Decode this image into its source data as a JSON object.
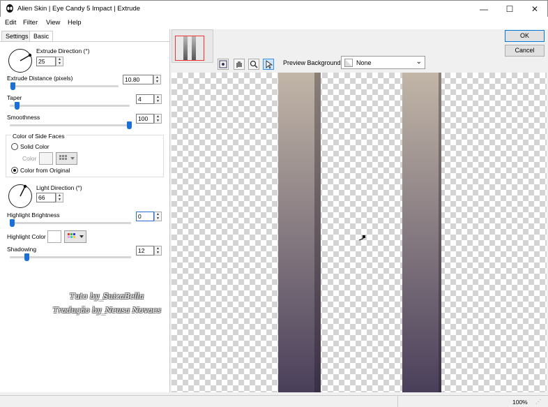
{
  "window": {
    "title": "Alien Skin | Eye Candy 5 Impact | Extrude",
    "minimize_glyph": "—",
    "maximize_glyph": "☐",
    "close_glyph": "✕"
  },
  "menu": [
    "Edit",
    "Filter",
    "View",
    "Help"
  ],
  "tabs": [
    "Settings",
    "Basic"
  ],
  "basic": {
    "extrude_direction": {
      "label": "Extrude Direction (°)",
      "value": "25"
    },
    "extrude_distance": {
      "label": "Extrude Distance (pixels)",
      "value": "10.80",
      "level": 0.05
    },
    "taper": {
      "label": "Taper",
      "value": "4",
      "level": 0.04
    },
    "smoothness": {
      "label": "Smoothness",
      "value": "100",
      "level": 1.0
    },
    "side_faces": {
      "group_label": "Color of Side Faces",
      "solid_label": "Solid Color",
      "color_label": "Color",
      "original_label": "Color from Original"
    },
    "light_direction": {
      "label": "Light Direction (°)",
      "value": "66"
    },
    "highlight_brightness": {
      "label": "Highlight Brightness",
      "value": "0",
      "level": 0.0
    },
    "highlight_color": {
      "label": "Highlight Color"
    },
    "shadowing": {
      "label": "Shadowing",
      "value": "12",
      "level": 0.12
    }
  },
  "buttons": {
    "ok": "OK",
    "cancel": "Cancel"
  },
  "preview": {
    "background_label": "Preview Background:",
    "background_value": "None",
    "zoom": "100%"
  },
  "watermark": {
    "line1": "Tuto by_SuizaBella",
    "line2": "Tradução by_Neusa Novaes"
  },
  "colors": {
    "accent": "#1a6fd8",
    "bar_top": "#c2b6a8",
    "bar_bottom": "#4a3f5a"
  }
}
